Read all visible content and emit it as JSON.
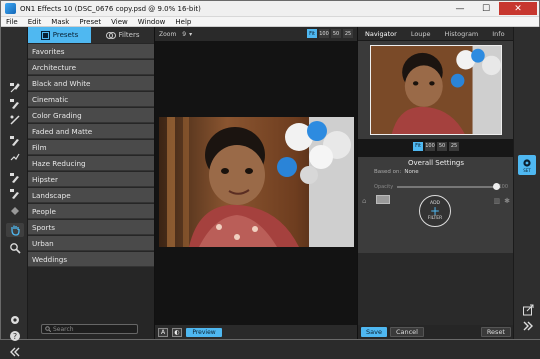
{
  "window": {
    "title": "ON1 Effects 10 (DSC_0676 copy.psd @ 9.0% 16-bit)",
    "minimize": "—",
    "maximize": "☐",
    "close": "✕"
  },
  "menu": [
    "File",
    "Edit",
    "Mask",
    "Preset",
    "View",
    "Window",
    "Help"
  ],
  "left_panel": {
    "tabs": {
      "presets": "Presets",
      "filters": "Filters"
    },
    "categories": [
      "Favorites",
      "Architecture",
      "Black and White",
      "Cinematic",
      "Color Grading",
      "Faded and Matte",
      "Film",
      "Haze Reducing",
      "Hipster",
      "Landscape",
      "People",
      "Sports",
      "Urban",
      "Weddings"
    ],
    "search_placeholder": "Search"
  },
  "center": {
    "zoom_label": "Zoom",
    "zoom_value": "9",
    "zoom_buttons": [
      "Fit",
      "100",
      "50",
      "25"
    ],
    "preview_label": "Preview",
    "compare_a": "A"
  },
  "right_panel": {
    "tabs": [
      "Navigator",
      "Loupe",
      "Histogram",
      "Info"
    ],
    "nav_zoom_buttons": [
      "Fit",
      "100",
      "50",
      "25"
    ],
    "overall": {
      "title": "Overall Settings",
      "based_on_label": "Based on:",
      "based_on_value": "None",
      "opacity_label": "Opacity",
      "opacity_value": "100",
      "opacity_fraction": 1.0,
      "add_filter_top": "ADD",
      "add_filter_bottom": "FILTER"
    },
    "buttons": {
      "save": "Save",
      "cancel": "Cancel",
      "reset": "Reset"
    }
  },
  "right_toolbar": {
    "settings_label": "SET"
  },
  "colors": {
    "accent": "#4fb8f1",
    "panel": "#4a4a4a"
  }
}
